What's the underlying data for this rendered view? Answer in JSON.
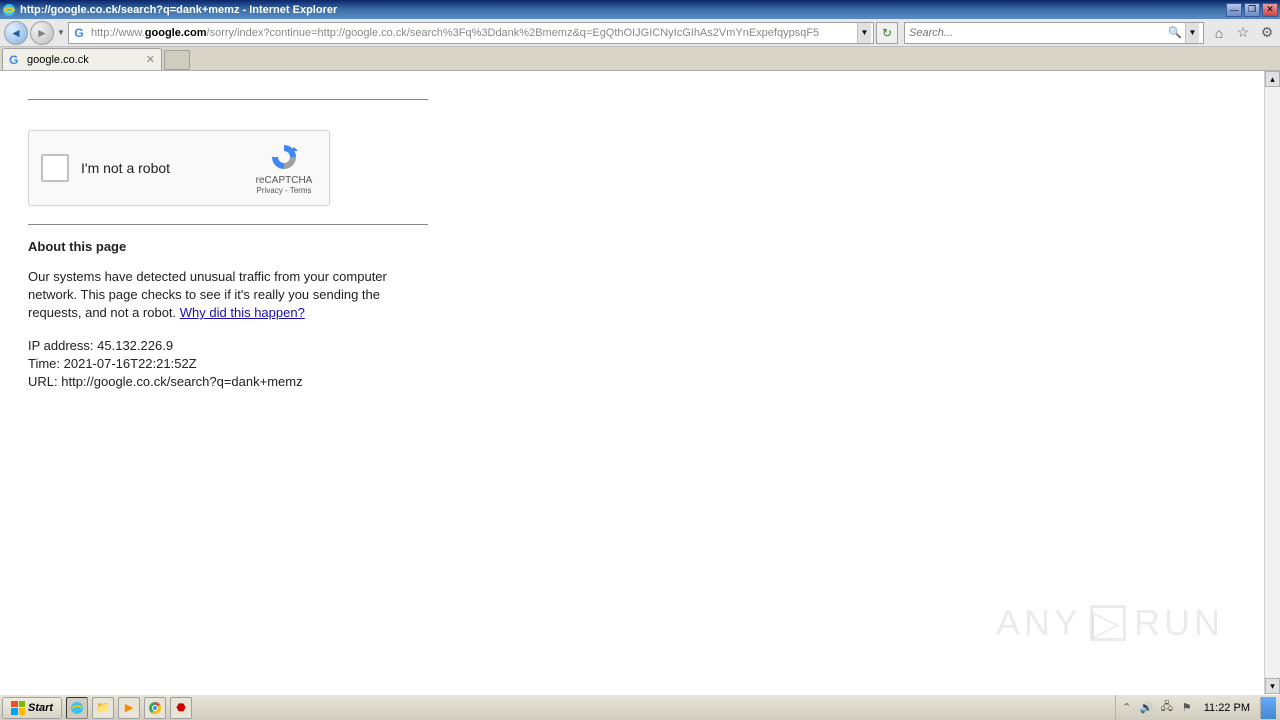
{
  "window": {
    "title": "http://google.co.ck/search?q=dank+memz - Internet Explorer"
  },
  "toolbar": {
    "url_prefix": "http://www.",
    "url_domain": "google.com",
    "url_suffix": "/sorry/index?continue=http://google.co.ck/search%3Fq%3Ddank%2Bmemz&q=EgQthOIJGICNyIcGIhAs2VmYnExpefqypsqF5",
    "search_placeholder": "Search..."
  },
  "tab": {
    "label": "google.co.ck"
  },
  "recaptcha": {
    "label": "I'm not a robot",
    "brand": "reCAPTCHA",
    "privacy": "Privacy",
    "terms": "Terms"
  },
  "page": {
    "about_heading": "About this page",
    "about_text": "Our systems have detected unusual traffic from your computer network. This page checks to see if it's really you sending the requests, and not a robot. ",
    "why_link": "Why did this happen?",
    "ip_label": "IP address: ",
    "ip_value": "45.132.226.9",
    "time_label": "Time: ",
    "time_value": "2021-07-16T22:21:52Z",
    "url_label": "URL: ",
    "url_value": "http://google.co.ck/search?q=dank+memz"
  },
  "watermark": {
    "t1": "ANY",
    "t2": "RUN"
  },
  "taskbar": {
    "start": "Start",
    "clock": "11:22 PM"
  }
}
